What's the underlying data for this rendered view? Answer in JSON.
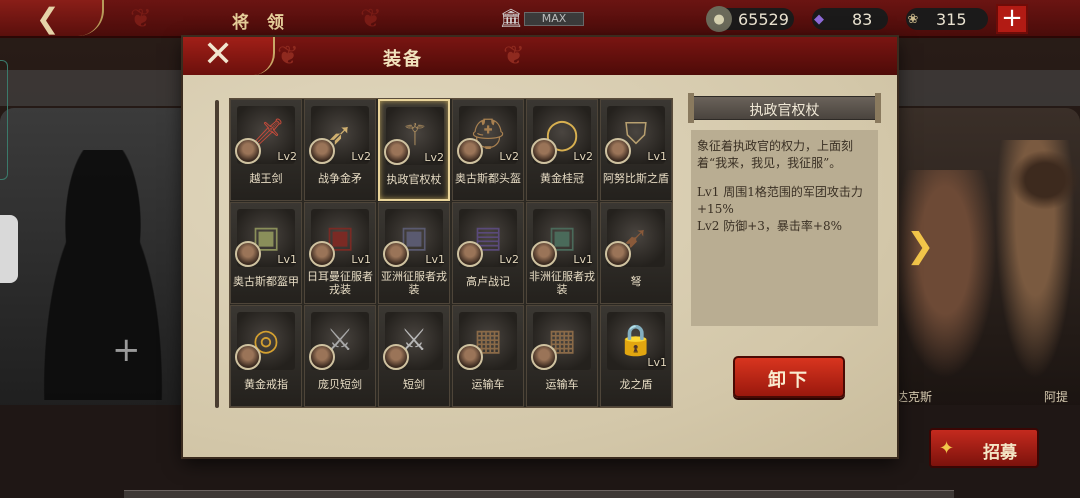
{
  "topbar": {
    "back_icon": "back-arrow-icon",
    "title": "将 领",
    "max_label": "MAX",
    "gold": "65529",
    "gems": "83",
    "food": "315"
  },
  "background": {
    "hero_names": [
      "达克斯",
      "阿提"
    ]
  },
  "recruit_button": "招募",
  "modal": {
    "title": "装备",
    "close_icon": "close-icon",
    "items": [
      {
        "name": "越王剑",
        "level": "Lv2",
        "icon": "sword-icon",
        "color": "#c44a3a"
      },
      {
        "name": "战争金矛",
        "level": "Lv2",
        "icon": "spear-icon",
        "color": "#d0b070"
      },
      {
        "name": "执政官权杖",
        "level": "Lv2",
        "icon": "scepter-icon",
        "color": "#b09060",
        "selected": true
      },
      {
        "name": "奥古斯都头盔",
        "level": "Lv2",
        "icon": "helmet-icon",
        "color": "#a88050"
      },
      {
        "name": "黄金桂冠",
        "level": "Lv2",
        "icon": "laurel-crown-icon",
        "color": "#d8b050"
      },
      {
        "name": "阿努比斯之盾",
        "level": "Lv1",
        "icon": "shield-icon",
        "color": "#b8a070"
      },
      {
        "name": "奥古斯都盔甲",
        "level": "Lv1",
        "icon": "armor-icon",
        "color": "#8a8f5a"
      },
      {
        "name": "日耳曼征服者戎装",
        "level": "Lv1",
        "icon": "armor-icon",
        "color": "#7a2a24"
      },
      {
        "name": "亚洲征服者戎装",
        "level": "Lv1",
        "icon": "armor-icon",
        "color": "#5a5a70"
      },
      {
        "name": "高卢战记",
        "level": "Lv2",
        "icon": "book-icon",
        "color": "#5a4a7a"
      },
      {
        "name": "非洲征服者戎装",
        "level": "Lv1",
        "icon": "armor-icon",
        "color": "#4a6a5a"
      },
      {
        "name": "弩",
        "level": "",
        "icon": "crossbow-icon",
        "color": "#8a5a3a"
      },
      {
        "name": "黄金戒指",
        "level": "",
        "icon": "ring-icon",
        "color": "#d4a030"
      },
      {
        "name": "庞贝短剑",
        "level": "",
        "icon": "short-sword-icon",
        "color": "#a8a8a8"
      },
      {
        "name": "短剑",
        "level": "",
        "icon": "short-sword-icon",
        "color": "#b8b8b8"
      },
      {
        "name": "运输车",
        "level": "",
        "icon": "cart-icon",
        "color": "#8a6a48"
      },
      {
        "name": "运输车",
        "level": "",
        "icon": "cart-icon",
        "color": "#8a6a48"
      },
      {
        "name": "龙之盾",
        "level": "Lv1",
        "icon": "lock-icon",
        "color": "#cfcfcf"
      }
    ],
    "detail": {
      "title": "执政官权杖",
      "description": "象征着执政官的权力，上面刻着“我来，我见，我征服”。",
      "effects": [
        "Lv1  周围1格范围的军团攻击力+15%",
        "Lv2  防御+3，暴击率+8%"
      ]
    },
    "unequip_button": "卸下"
  }
}
